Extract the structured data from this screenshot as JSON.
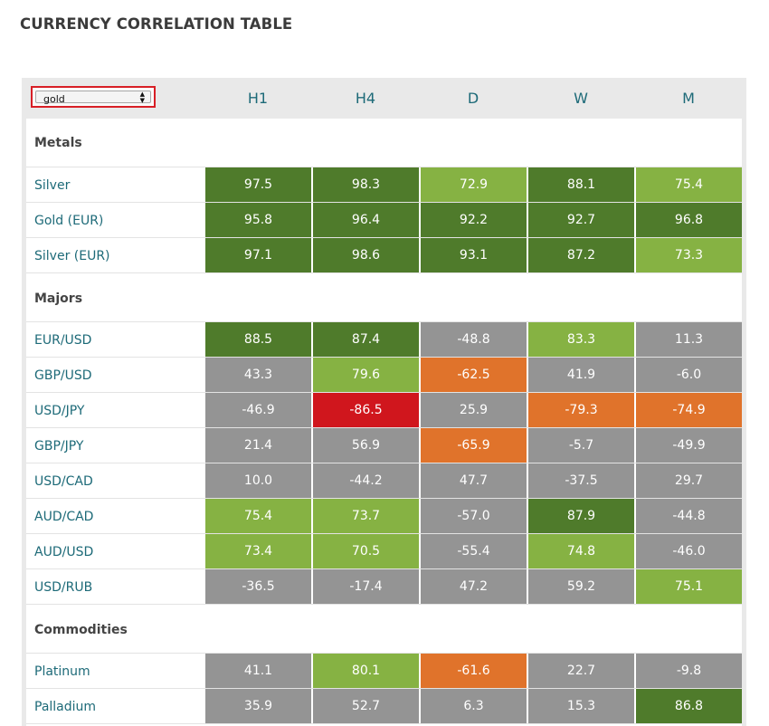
{
  "title": "CURRENCY CORRELATION TABLE",
  "selector": {
    "value": "gold",
    "arrows": "▲▼"
  },
  "columns": [
    "H1",
    "H4",
    "D",
    "W",
    "M"
  ],
  "sections": [
    {
      "name": "Metals",
      "rows": [
        {
          "pair": "Silver",
          "values": [
            "97.5",
            "98.3",
            "72.9",
            "88.1",
            "75.4"
          ],
          "colors": [
            "dg",
            "dg",
            "lg",
            "dg",
            "lg"
          ]
        },
        {
          "pair": "Gold (EUR)",
          "values": [
            "95.8",
            "96.4",
            "92.2",
            "92.7",
            "96.8"
          ],
          "colors": [
            "dg",
            "dg",
            "dg",
            "dg",
            "dg"
          ]
        },
        {
          "pair": "Silver (EUR)",
          "values": [
            "97.1",
            "98.6",
            "93.1",
            "87.2",
            "73.3"
          ],
          "colors": [
            "dg",
            "dg",
            "dg",
            "dg",
            "lg"
          ]
        }
      ]
    },
    {
      "name": "Majors",
      "rows": [
        {
          "pair": "EUR/USD",
          "values": [
            "88.5",
            "87.4",
            "-48.8",
            "83.3",
            "11.3"
          ],
          "colors": [
            "dg",
            "dg",
            "gr",
            "lg",
            "gr"
          ]
        },
        {
          "pair": "GBP/USD",
          "values": [
            "43.3",
            "79.6",
            "-62.5",
            "41.9",
            "-6.0"
          ],
          "colors": [
            "gr",
            "lg",
            "or",
            "gr",
            "gr"
          ]
        },
        {
          "pair": "USD/JPY",
          "values": [
            "-46.9",
            "-86.5",
            "25.9",
            "-79.3",
            "-74.9"
          ],
          "colors": [
            "gr",
            "rd",
            "gr",
            "or",
            "or"
          ]
        },
        {
          "pair": "GBP/JPY",
          "values": [
            "21.4",
            "56.9",
            "-65.9",
            "-5.7",
            "-49.9"
          ],
          "colors": [
            "gr",
            "gr",
            "or",
            "gr",
            "gr"
          ]
        },
        {
          "pair": "USD/CAD",
          "values": [
            "10.0",
            "-44.2",
            "47.7",
            "-37.5",
            "29.7"
          ],
          "colors": [
            "gr",
            "gr",
            "gr",
            "gr",
            "gr"
          ]
        },
        {
          "pair": "AUD/CAD",
          "values": [
            "75.4",
            "73.7",
            "-57.0",
            "87.9",
            "-44.8"
          ],
          "colors": [
            "lg",
            "lg",
            "gr",
            "dg",
            "gr"
          ]
        },
        {
          "pair": "AUD/USD",
          "values": [
            "73.4",
            "70.5",
            "-55.4",
            "74.8",
            "-46.0"
          ],
          "colors": [
            "lg",
            "lg",
            "gr",
            "lg",
            "gr"
          ]
        },
        {
          "pair": "USD/RUB",
          "values": [
            "-36.5",
            "-17.4",
            "47.2",
            "59.2",
            "75.1"
          ],
          "colors": [
            "gr",
            "gr",
            "gr",
            "gr",
            "lg"
          ]
        }
      ]
    },
    {
      "name": "Commodities",
      "rows": [
        {
          "pair": "Platinum",
          "values": [
            "41.1",
            "80.1",
            "-61.6",
            "22.7",
            "-9.8"
          ],
          "colors": [
            "gr",
            "lg",
            "or",
            "gr",
            "gr"
          ]
        },
        {
          "pair": "Palladium",
          "values": [
            "35.9",
            "52.7",
            "6.3",
            "15.3",
            "86.8"
          ],
          "colors": [
            "gr",
            "gr",
            "gr",
            "gr",
            "dg"
          ]
        }
      ]
    }
  ],
  "palette": {
    "dg": "#4f7b2b",
    "lg": "#86b243",
    "gr": "#949494",
    "or": "#e0732b",
    "rd": "#d0161d"
  }
}
